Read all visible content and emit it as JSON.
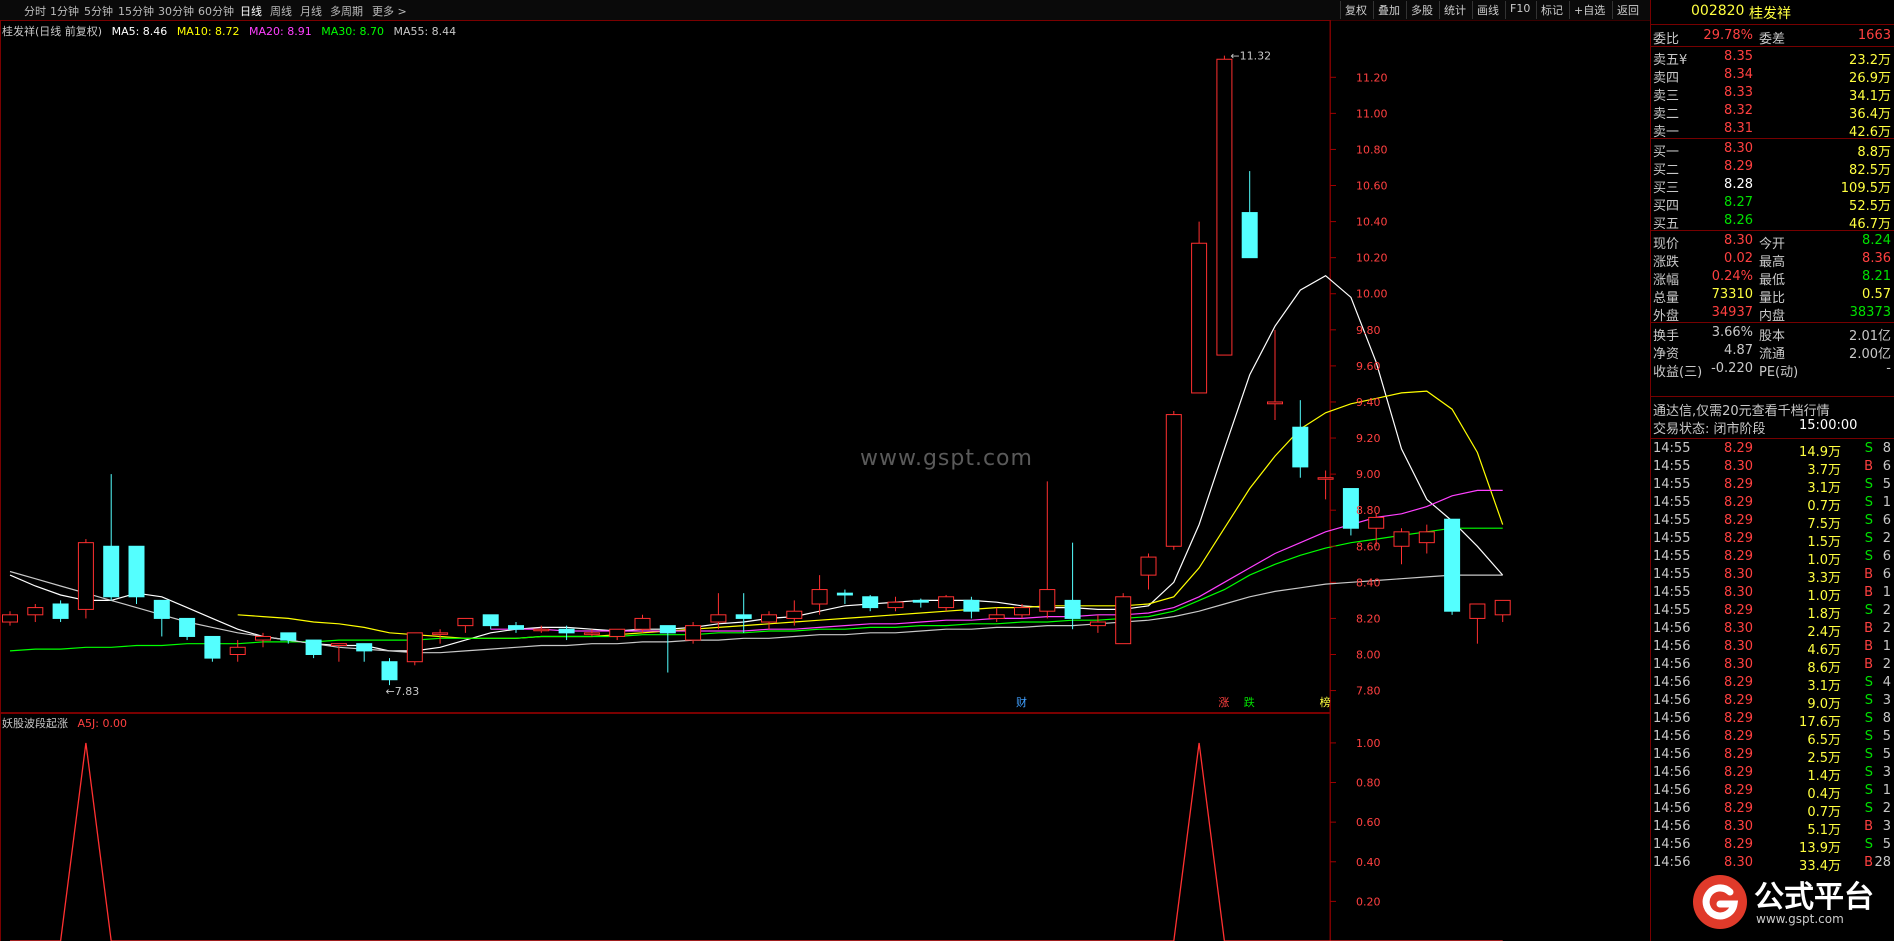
{
  "toolbar": {
    "periods": [
      "分时",
      "1分钟",
      "5分钟",
      "15分钟",
      "30分钟",
      "60分钟",
      "日线",
      "周线",
      "月线",
      "多周期",
      "更多 >"
    ],
    "active_period": "日线",
    "buttons": [
      "复权",
      "叠加",
      "多股",
      "统计",
      "画线",
      "F10",
      "标记",
      "+自选",
      "返回"
    ]
  },
  "chart_header": {
    "title": "桂发祥(日线 前复权)",
    "ma": [
      {
        "label": "MA5: 8.46",
        "color": "#ffffff"
      },
      {
        "label": "MA10: 8.72",
        "color": "#ffff00"
      },
      {
        "label": "MA20: 8.91",
        "color": "#ff40ff"
      },
      {
        "label": "MA30: 8.70",
        "color": "#00ff00"
      },
      {
        "label": "MA55: 8.44",
        "color": "#c8c8c8"
      }
    ]
  },
  "watermark": "www.gspt.com",
  "chart_data": {
    "type": "candlestick",
    "y_axis_ticks": [
      "11.20",
      "11.00",
      "10.80",
      "10.60",
      "10.40",
      "10.20",
      "10.00",
      "9.80",
      "9.60",
      "9.40",
      "9.20",
      "9.00",
      "8.80",
      "8.60",
      "8.40",
      "8.20",
      "8.00",
      "7.80"
    ],
    "ylim": [
      7.72,
      11.44
    ],
    "annotations": {
      "high_label": "11.32",
      "low_label": "7.83"
    },
    "event_markers": [
      {
        "label": "财",
        "color": "#40a0ff"
      },
      {
        "label": "涨",
        "color": "#ff4040"
      },
      {
        "label": "跌",
        "color": "#00e000"
      },
      {
        "label": "榜",
        "color": "#ffff40"
      }
    ],
    "candles": [
      [
        8.18,
        8.24,
        8.16,
        8.22
      ],
      [
        8.22,
        8.28,
        8.18,
        8.26
      ],
      [
        8.28,
        8.3,
        8.18,
        8.2
      ],
      [
        8.25,
        8.64,
        8.2,
        8.62
      ],
      [
        8.6,
        9.0,
        8.3,
        8.32
      ],
      [
        8.6,
        8.6,
        8.28,
        8.32
      ],
      [
        8.3,
        8.3,
        8.1,
        8.2
      ],
      [
        8.2,
        8.2,
        8.08,
        8.1
      ],
      [
        8.1,
        8.1,
        7.96,
        7.98
      ],
      [
        8.0,
        8.08,
        7.96,
        8.04
      ],
      [
        8.08,
        8.12,
        8.04,
        8.1
      ],
      [
        8.12,
        8.12,
        8.06,
        8.08
      ],
      [
        8.08,
        8.08,
        7.98,
        8.0
      ],
      [
        8.05,
        8.06,
        7.96,
        8.06
      ],
      [
        8.06,
        8.06,
        7.96,
        8.02
      ],
      [
        7.96,
        7.98,
        7.83,
        7.86
      ],
      [
        7.96,
        8.12,
        7.94,
        8.12
      ],
      [
        8.12,
        8.14,
        8.06,
        8.12
      ],
      [
        8.16,
        8.2,
        8.12,
        8.2
      ],
      [
        8.22,
        8.22,
        8.14,
        8.16
      ],
      [
        8.16,
        8.18,
        8.12,
        8.14
      ],
      [
        8.14,
        8.16,
        8.12,
        8.14
      ],
      [
        8.14,
        8.16,
        8.08,
        8.12
      ],
      [
        8.12,
        8.14,
        8.1,
        8.12
      ],
      [
        8.1,
        8.14,
        8.08,
        8.14
      ],
      [
        8.14,
        8.22,
        8.12,
        8.2
      ],
      [
        8.16,
        8.16,
        7.9,
        8.12
      ],
      [
        8.08,
        8.18,
        8.06,
        8.16
      ],
      [
        8.18,
        8.34,
        8.14,
        8.22
      ],
      [
        8.22,
        8.34,
        8.12,
        8.2
      ],
      [
        8.18,
        8.24,
        8.14,
        8.22
      ],
      [
        8.2,
        8.3,
        8.16,
        8.24
      ],
      [
        8.28,
        8.44,
        8.22,
        8.36
      ],
      [
        8.34,
        8.36,
        8.28,
        8.33
      ],
      [
        8.32,
        8.33,
        8.24,
        8.26
      ],
      [
        8.26,
        8.32,
        8.24,
        8.29
      ],
      [
        8.3,
        8.31,
        8.26,
        8.29
      ],
      [
        8.26,
        8.33,
        8.24,
        8.32
      ],
      [
        8.3,
        8.32,
        8.2,
        8.24
      ],
      [
        8.2,
        8.26,
        8.18,
        8.22
      ],
      [
        8.22,
        8.28,
        8.2,
        8.26
      ],
      [
        8.24,
        8.96,
        8.2,
        8.36
      ],
      [
        8.3,
        8.62,
        8.14,
        8.2
      ],
      [
        8.16,
        8.22,
        8.12,
        8.18
      ],
      [
        8.06,
        8.34,
        8.06,
        8.32
      ],
      [
        8.44,
        8.56,
        8.36,
        8.54
      ],
      [
        8.6,
        9.35,
        8.58,
        9.33
      ],
      [
        9.45,
        10.4,
        9.45,
        10.28
      ],
      [
        9.66,
        11.32,
        9.66,
        11.3
      ],
      [
        10.45,
        10.68,
        10.2,
        10.2
      ],
      [
        9.39,
        9.8,
        9.3,
        9.4
      ],
      [
        9.26,
        9.41,
        8.98,
        9.04
      ],
      [
        8.98,
        9.02,
        8.86,
        8.98
      ],
      [
        8.92,
        8.92,
        8.66,
        8.7
      ],
      [
        8.7,
        8.78,
        8.6,
        8.76
      ],
      [
        8.6,
        8.7,
        8.5,
        8.68
      ],
      [
        8.62,
        8.72,
        8.56,
        8.68
      ],
      [
        8.75,
        8.75,
        8.22,
        8.24
      ],
      [
        8.2,
        8.28,
        8.06,
        8.28
      ],
      [
        8.22,
        8.3,
        8.18,
        8.3
      ]
    ],
    "ma_lines": {
      "MA5": [
        8.44,
        8.38,
        8.33,
        8.3,
        8.3,
        8.34,
        8.32,
        8.26,
        8.2,
        8.14,
        8.1,
        8.08,
        8.06,
        8.05,
        8.05,
        8.02,
        8.02,
        8.04,
        8.08,
        8.12,
        8.14,
        8.15,
        8.15,
        8.14,
        8.13,
        8.14,
        8.14,
        8.15,
        8.17,
        8.18,
        8.2,
        8.21,
        8.24,
        8.27,
        8.28,
        8.29,
        8.3,
        8.3,
        8.3,
        8.29,
        8.27,
        8.26,
        8.26,
        8.25,
        8.25,
        8.27,
        8.4,
        8.72,
        9.14,
        9.55,
        9.82,
        10.02,
        10.1,
        9.98,
        9.62,
        9.14,
        8.86,
        8.74,
        8.6,
        8.44
      ],
      "MA10": [
        null,
        null,
        null,
        null,
        null,
        null,
        null,
        null,
        null,
        8.22,
        8.21,
        8.2,
        8.18,
        8.17,
        8.15,
        8.12,
        8.11,
        8.1,
        8.09,
        8.09,
        8.09,
        8.1,
        8.1,
        8.1,
        8.11,
        8.12,
        8.13,
        8.14,
        8.15,
        8.16,
        8.17,
        8.18,
        8.19,
        8.2,
        8.21,
        8.22,
        8.23,
        8.24,
        8.25,
        8.26,
        8.26,
        8.27,
        8.27,
        8.27,
        8.27,
        8.28,
        8.32,
        8.48,
        8.7,
        8.92,
        9.1,
        9.25,
        9.34,
        9.39,
        9.42,
        9.45,
        9.46,
        9.36,
        9.12,
        8.72
      ],
      "MA20": [
        null,
        null,
        null,
        null,
        null,
        null,
        null,
        null,
        null,
        null,
        null,
        null,
        null,
        null,
        null,
        null,
        null,
        null,
        null,
        8.14,
        8.14,
        8.14,
        8.13,
        8.13,
        8.13,
        8.13,
        8.13,
        8.13,
        8.13,
        8.13,
        8.14,
        8.14,
        8.15,
        8.16,
        8.17,
        8.17,
        8.18,
        8.19,
        8.19,
        8.2,
        8.2,
        8.21,
        8.21,
        8.22,
        8.22,
        8.23,
        8.26,
        8.32,
        8.4,
        8.48,
        8.56,
        8.62,
        8.68,
        8.72,
        8.76,
        8.78,
        8.82,
        8.88,
        8.91,
        8.91
      ],
      "MA30": [
        8.02,
        8.03,
        8.03,
        8.04,
        8.04,
        8.05,
        8.05,
        8.06,
        8.06,
        8.06,
        8.07,
        8.07,
        8.07,
        8.08,
        8.08,
        8.08,
        8.08,
        8.09,
        8.09,
        8.09,
        8.09,
        8.1,
        8.1,
        8.1,
        8.1,
        8.11,
        8.11,
        8.11,
        8.12,
        8.12,
        8.13,
        8.13,
        8.14,
        8.14,
        8.15,
        8.15,
        8.16,
        8.16,
        8.17,
        8.17,
        8.18,
        8.18,
        8.19,
        8.19,
        8.2,
        8.21,
        8.24,
        8.3,
        8.36,
        8.44,
        8.5,
        8.55,
        8.59,
        8.62,
        8.64,
        8.66,
        8.68,
        8.7,
        8.7,
        8.7
      ],
      "MA55": [
        8.46,
        8.42,
        8.38,
        8.34,
        8.3,
        8.26,
        8.22,
        8.18,
        8.15,
        8.12,
        8.1,
        8.08,
        8.06,
        8.04,
        8.03,
        8.02,
        8.01,
        8.01,
        8.02,
        8.03,
        8.04,
        8.05,
        8.05,
        8.06,
        8.06,
        8.07,
        8.07,
        8.08,
        8.08,
        8.09,
        8.09,
        8.1,
        8.11,
        8.11,
        8.12,
        8.12,
        8.13,
        8.14,
        8.14,
        8.15,
        8.15,
        8.16,
        8.16,
        8.17,
        8.18,
        8.19,
        8.21,
        8.24,
        8.28,
        8.32,
        8.35,
        8.37,
        8.39,
        8.4,
        8.41,
        8.42,
        8.43,
        8.44,
        8.44,
        8.44
      ]
    },
    "indicator": {
      "name": "妖股波段起涨",
      "label": "A5J: 0.00",
      "y_ticks": [
        "1.00",
        "0.80",
        "0.60",
        "0.40",
        "0.20"
      ],
      "ylim": [
        0,
        1.05
      ],
      "values": [
        0,
        0,
        0,
        1,
        0,
        0,
        0,
        0,
        0,
        0,
        0,
        0,
        0,
        0,
        0,
        0,
        0,
        0,
        0,
        0,
        0,
        0,
        0,
        0,
        0,
        0,
        0,
        0,
        0,
        0,
        0,
        0,
        0,
        0,
        0,
        0,
        0,
        0,
        0,
        0,
        0,
        0,
        0,
        0,
        0,
        0,
        0,
        1,
        0,
        0,
        0,
        0,
        0,
        0,
        0,
        0,
        0,
        0,
        0,
        0
      ]
    }
  },
  "quote": {
    "code": "002820",
    "name": "桂发祥",
    "webi_label": "委比",
    "webi_value": "29.78%",
    "weicha_label": "委差",
    "weicha_value": "1663",
    "asks": [
      {
        "label": "卖五",
        "mark": "¥",
        "price": "8.35",
        "vol": "23.2万"
      },
      {
        "label": "卖四",
        "mark": "",
        "price": "8.34",
        "vol": "26.9万"
      },
      {
        "label": "卖三",
        "mark": "",
        "price": "8.33",
        "vol": "34.1万"
      },
      {
        "label": "卖二",
        "mark": "",
        "price": "8.32",
        "vol": "36.4万"
      },
      {
        "label": "卖一",
        "mark": "",
        "price": "8.31",
        "vol": "42.6万"
      }
    ],
    "bids": [
      {
        "label": "买一",
        "price": "8.30",
        "vol": "8.8万",
        "color": "#ff4040"
      },
      {
        "label": "买二",
        "price": "8.29",
        "vol": "82.5万",
        "color": "#ff4040"
      },
      {
        "label": "买三",
        "price": "8.28",
        "vol": "109.5万",
        "color": "#ffffff"
      },
      {
        "label": "买四",
        "price": "8.27",
        "vol": "52.5万",
        "color": "#00e000"
      },
      {
        "label": "买五",
        "price": "8.26",
        "vol": "46.7万",
        "color": "#00e000"
      }
    ],
    "stats": [
      {
        "l1": "现价",
        "v1": "8.30",
        "c1": "#ff4040",
        "l2": "今开",
        "v2": "8.24",
        "c2": "#00e000"
      },
      {
        "l1": "涨跌",
        "v1": "0.02",
        "c1": "#ff4040",
        "l2": "最高",
        "v2": "8.36",
        "c2": "#ff4040"
      },
      {
        "l1": "涨幅",
        "v1": "0.24%",
        "c1": "#ff4040",
        "l2": "最低",
        "v2": "8.21",
        "c2": "#00e000"
      },
      {
        "l1": "总量",
        "v1": "73310",
        "c1": "#ffff40",
        "l2": "量比",
        "v2": "0.57",
        "c2": "#ffff40"
      },
      {
        "l1": "外盘",
        "v1": "34937",
        "c1": "#ff4040",
        "l2": "内盘",
        "v2": "38373",
        "c2": "#00e000"
      }
    ],
    "stats2": [
      {
        "l1": "换手",
        "v1": "3.66%",
        "l2": "股本",
        "v2": "2.01亿"
      },
      {
        "l1": "净资",
        "v1": "4.87",
        "l2": "流通",
        "v2": "2.00亿"
      },
      {
        "l1": "收益(三)",
        "v1": "-0.220",
        "l2": "PE(动)",
        "v2": "-"
      }
    ],
    "notice": "通达信,仅需20元查看千档行情",
    "trade_state_label": "交易状态: 闭市阶段",
    "trade_state_time": "15:00:00",
    "ticks": [
      [
        "14:55",
        "8.29",
        "14.9万",
        "S",
        "8"
      ],
      [
        "14:55",
        "8.30",
        "3.7万",
        "B",
        "6"
      ],
      [
        "14:55",
        "8.29",
        "3.1万",
        "S",
        "5"
      ],
      [
        "14:55",
        "8.29",
        "0.7万",
        "S",
        "1"
      ],
      [
        "14:55",
        "8.29",
        "7.5万",
        "S",
        "6"
      ],
      [
        "14:55",
        "8.29",
        "1.5万",
        "S",
        "2"
      ],
      [
        "14:55",
        "8.29",
        "1.0万",
        "S",
        "6"
      ],
      [
        "14:55",
        "8.30",
        "3.3万",
        "B",
        "6"
      ],
      [
        "14:55",
        "8.30",
        "1.0万",
        "B",
        "1"
      ],
      [
        "14:55",
        "8.29",
        "1.8万",
        "S",
        "2"
      ],
      [
        "14:56",
        "8.30",
        "2.4万",
        "B",
        "2"
      ],
      [
        "14:56",
        "8.30",
        "4.6万",
        "B",
        "1"
      ],
      [
        "14:56",
        "8.30",
        "8.6万",
        "B",
        "2"
      ],
      [
        "14:56",
        "8.29",
        "3.1万",
        "S",
        "4"
      ],
      [
        "14:56",
        "8.29",
        "9.0万",
        "S",
        "3"
      ],
      [
        "14:56",
        "8.29",
        "17.6万",
        "S",
        "8"
      ],
      [
        "14:56",
        "8.29",
        "6.5万",
        "S",
        "5"
      ],
      [
        "14:56",
        "8.29",
        "2.5万",
        "S",
        "5"
      ],
      [
        "14:56",
        "8.29",
        "1.4万",
        "S",
        "3"
      ],
      [
        "14:56",
        "8.29",
        "0.4万",
        "S",
        "1"
      ],
      [
        "14:56",
        "8.29",
        "0.7万",
        "S",
        "2"
      ],
      [
        "14:56",
        "8.30",
        "5.1万",
        "B",
        "3"
      ],
      [
        "14:56",
        "8.29",
        "13.9万",
        "S",
        "5"
      ],
      [
        "14:56",
        "8.30",
        "33.4万",
        "B",
        "28"
      ]
    ]
  },
  "logo": {
    "text": "公式平台",
    "sub": "www.gspt.com"
  }
}
